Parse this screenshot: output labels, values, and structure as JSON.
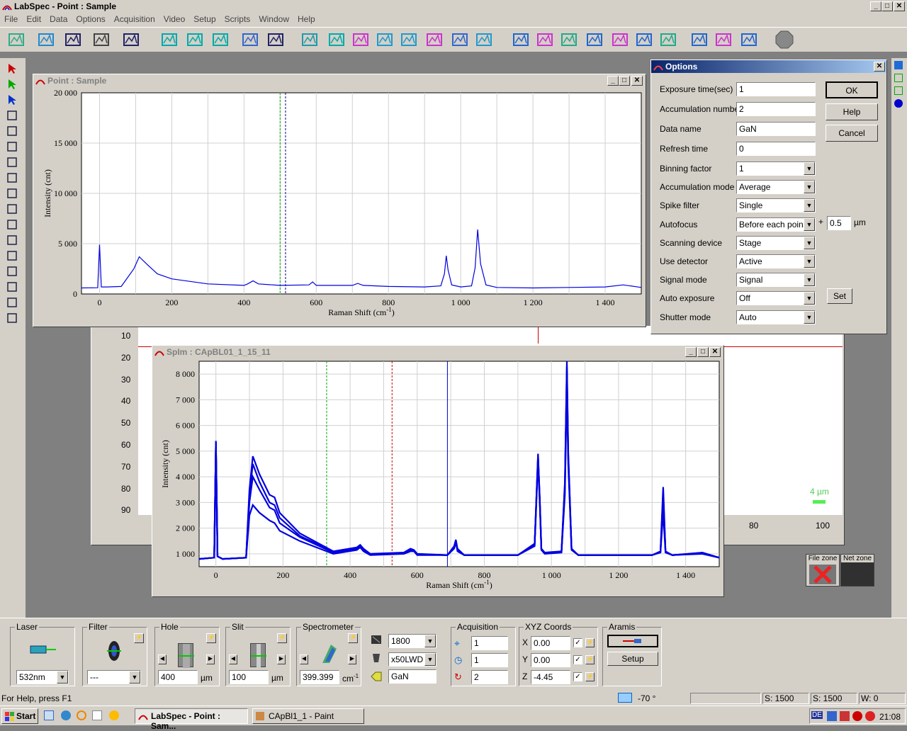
{
  "app": {
    "title": "LabSpec - Point : Sample"
  },
  "menu": [
    "File",
    "Edit",
    "Data",
    "Options",
    "Acquisition",
    "Video",
    "Setup",
    "Scripts",
    "Window",
    "Help"
  ],
  "point_window": {
    "title": "Point : Sample",
    "xlabel": "Raman Shift (cm",
    "xlabel_sup": "-1",
    "xlabel_end": ")",
    "ylabel": "Intensity (cnt)",
    "yticks": [
      "20 000",
      "15 000",
      "10 000",
      "5 000",
      "0"
    ],
    "xticks": [
      "0",
      "200",
      "400",
      "600",
      "800",
      "1 000",
      "1 200",
      "1 400"
    ]
  },
  "spim_window": {
    "title": "SpIm : CApBL01_1_15_11",
    "xlabel": "Raman Shift (cm",
    "xlabel_sup": "-1",
    "xlabel_end": ")",
    "ylabel": "Intensity (cnt)",
    "yticks": [
      "8 000",
      "7 000",
      "6 000",
      "5 000",
      "4 000",
      "3 000",
      "2 000",
      "1 000"
    ],
    "xticks": [
      "0",
      "200",
      "400",
      "600",
      "800",
      "1 000",
      "1 200",
      "1 400"
    ]
  },
  "image_window": {
    "yticks": [
      "10",
      "20",
      "30",
      "40",
      "50",
      "60",
      "70",
      "80",
      "90"
    ],
    "xticks": [
      "80",
      "100"
    ],
    "scale_label": "4 µm"
  },
  "chart_data": [
    {
      "type": "line",
      "title": "Point : Sample",
      "xlabel": "Raman Shift (cm-1)",
      "ylabel": "Intensity (cnt)",
      "xlim": [
        -50,
        1500
      ],
      "ylim": [
        0,
        20000
      ],
      "series": [
        {
          "x": [
            -50,
            -5,
            0,
            5,
            20,
            60,
            95,
            110,
            130,
            160,
            200,
            300,
            400,
            410,
            425,
            440,
            500,
            580,
            590,
            600,
            700,
            715,
            730,
            800,
            900,
            945,
            955,
            960,
            965,
            975,
            1000,
            1030,
            1040,
            1047,
            1055,
            1070,
            1100,
            1200,
            1300,
            1400,
            1450,
            1500
          ],
          "values": [
            600,
            620,
            4900,
            700,
            700,
            750,
            2500,
            3700,
            3000,
            2000,
            1500,
            1000,
            850,
            1000,
            1300,
            1000,
            850,
            900,
            1200,
            850,
            850,
            1050,
            850,
            750,
            700,
            800,
            2000,
            3800,
            2400,
            900,
            700,
            800,
            2600,
            6400,
            3000,
            900,
            650,
            600,
            650,
            700,
            900,
            650
          ]
        }
      ]
    },
    {
      "type": "line",
      "title": "SpIm : CApBL01_1_15_11",
      "xlabel": "Raman Shift (cm-1)",
      "ylabel": "Intensity (cnt)",
      "xlim": [
        -50,
        1500
      ],
      "ylim": [
        500,
        8500
      ],
      "series": [
        {
          "x": [
            -50,
            -5,
            0,
            5,
            20,
            90,
            100,
            110,
            130,
            160,
            175,
            190,
            250,
            350,
            420,
            430,
            440,
            460,
            560,
            580,
            590,
            600,
            690,
            710,
            715,
            720,
            740,
            900,
            950,
            960,
            965,
            970,
            980,
            1030,
            1040,
            1046,
            1050,
            1060,
            1080,
            1300,
            1325,
            1333,
            1340,
            1360,
            1450,
            1500
          ],
          "values": [
            800,
            850,
            5400,
            900,
            800,
            850,
            3500,
            4800,
            4100,
            3300,
            3200,
            2600,
            1800,
            1100,
            1250,
            1350,
            1200,
            1000,
            1050,
            1200,
            1150,
            1000,
            950,
            1300,
            1550,
            1200,
            950,
            950,
            1400,
            4900,
            3200,
            1200,
            1050,
            1100,
            3800,
            8500,
            5000,
            1200,
            950,
            950,
            1100,
            3600,
            1100,
            950,
            1050,
            850
          ]
        },
        {
          "x": [
            -50,
            -5,
            0,
            5,
            20,
            90,
            100,
            110,
            130,
            160,
            175,
            190,
            250,
            350,
            420,
            430,
            440,
            460,
            560,
            580,
            590,
            600,
            690,
            710,
            715,
            720,
            740,
            900,
            950,
            960,
            965,
            970,
            980,
            1030,
            1040,
            1046,
            1050,
            1060,
            1080,
            1300,
            1325,
            1333,
            1340,
            1360,
            1450,
            1500
          ],
          "values": [
            800,
            850,
            5200,
            900,
            800,
            850,
            2500,
            2900,
            2600,
            2300,
            2200,
            1900,
            1500,
            1000,
            1150,
            1250,
            1100,
            950,
            1000,
            1100,
            1100,
            950,
            950,
            1200,
            1450,
            1100,
            950,
            950,
            1300,
            4600,
            3000,
            1150,
            1000,
            1050,
            3300,
            7600,
            4500,
            1150,
            950,
            950,
            1050,
            2600,
            1050,
            950,
            1000,
            850
          ]
        },
        {
          "x": [
            -50,
            -5,
            0,
            5,
            20,
            90,
            100,
            110,
            130,
            160,
            175,
            190,
            250,
            350,
            420,
            430,
            440,
            460,
            560,
            580,
            590,
            600,
            690,
            710,
            715,
            720,
            740,
            900,
            950,
            960,
            965,
            970,
            980,
            1030,
            1040,
            1046,
            1050,
            1060,
            1080,
            1300,
            1325,
            1333,
            1340,
            1360,
            1450,
            1500
          ],
          "values": [
            800,
            850,
            5300,
            900,
            800,
            850,
            3000,
            4000,
            3500,
            2800,
            2700,
            2200,
            1650,
            1050,
            1200,
            1300,
            1150,
            975,
            1025,
            1150,
            1125,
            975,
            950,
            1250,
            1500,
            1150,
            950,
            950,
            1350,
            4750,
            3100,
            1175,
            1025,
            1075,
            3550,
            8100,
            4750,
            1175,
            950,
            950,
            1075,
            3100,
            1075,
            950,
            1025,
            850
          ]
        },
        {
          "x": [
            -50,
            -5,
            0,
            5,
            20,
            90,
            100,
            110,
            130,
            160,
            175,
            190,
            250,
            350,
            420,
            430,
            440,
            460,
            560,
            580,
            590,
            600,
            690,
            710,
            715,
            720,
            740,
            900,
            950,
            960,
            965,
            970,
            980,
            1030,
            1040,
            1046,
            1050,
            1060,
            1080,
            1300,
            1325,
            1333,
            1340,
            1360,
            1450,
            1500
          ],
          "values": [
            800,
            850,
            5350,
            900,
            800,
            850,
            3300,
            4500,
            3800,
            3000,
            2900,
            2400,
            1700,
            1080,
            1220,
            1320,
            1180,
            990,
            1040,
            1180,
            1140,
            990,
            950,
            1280,
            1520,
            1180,
            950,
            950,
            1380,
            4850,
            3150,
            1190,
            1040,
            1090,
            3700,
            8300,
            4900,
            1190,
            950,
            950,
            1090,
            3400,
            1090,
            950,
            1040,
            850
          ]
        }
      ]
    }
  ],
  "options_dialog": {
    "title": "Options",
    "fields": [
      {
        "label": "Exposure time(sec)",
        "value": "1",
        "type": "text"
      },
      {
        "label": "Accumulation number",
        "value": "2",
        "type": "text"
      },
      {
        "label": "Data name",
        "value": "GaN",
        "type": "text"
      },
      {
        "label": "Refresh time",
        "value": "0",
        "type": "text"
      },
      {
        "label": "Binning factor",
        "value": "1",
        "type": "combo"
      },
      {
        "label": "Accumulation mode",
        "value": "Average",
        "type": "combo"
      },
      {
        "label": "Spike filter",
        "value": "Single",
        "type": "combo"
      },
      {
        "label": "Autofocus",
        "value": "Before each point",
        "type": "combo"
      },
      {
        "label": "Scanning device",
        "value": "Stage",
        "type": "combo"
      },
      {
        "label": "Use detector",
        "value": "Active",
        "type": "combo"
      },
      {
        "label": "Signal mode",
        "value": "Signal",
        "type": "combo"
      },
      {
        "label": "Auto exposure",
        "value": "Off",
        "type": "combo"
      },
      {
        "label": "Shutter mode",
        "value": "Auto",
        "type": "combo"
      }
    ],
    "autofocus_plus": "+",
    "autofocus_value": "0.5",
    "autofocus_unit": "µm",
    "ok": "OK",
    "help": "Help",
    "cancel": "Cancel",
    "set": "Set"
  },
  "file_zone": {
    "file": "File zone",
    "net": "Net zone"
  },
  "bottom": {
    "laser": {
      "label": "Laser",
      "value": "532nm"
    },
    "filter": {
      "label": "Filter",
      "value": "---"
    },
    "hole": {
      "label": "Hole",
      "value": "400",
      "unit": "µm"
    },
    "slit": {
      "label": "Slit",
      "value": "100",
      "unit": "µm"
    },
    "spectrometer": {
      "label": "Spectrometer",
      "value": "399.399",
      "unit": "cm",
      "unit_sup": "-1"
    },
    "grating": "1800",
    "objective": "x50LWD",
    "dataname": "GaN",
    "acquisition": {
      "label": "Acquisition",
      "v1": "1",
      "v2": "1",
      "v3": "2"
    },
    "xyz": {
      "label": "XYZ Coords",
      "x_label": "X",
      "x": "0.00",
      "y_label": "Y",
      "y": "0.00",
      "z_label": "Z",
      "z": "-4.45"
    },
    "aramis": {
      "label": "Aramis",
      "setup": "Setup"
    }
  },
  "status": {
    "help": "For Help, press F1",
    "angle": "-70 °",
    "s1": "S: 1500",
    "s2": "S: 1500",
    "w": "W: 0"
  },
  "taskbar": {
    "start": "Start",
    "task1": "LabSpec - Point : Sam...",
    "task2": "CApBl1_1 - Paint",
    "lang": "DE",
    "clock": "21:08"
  }
}
